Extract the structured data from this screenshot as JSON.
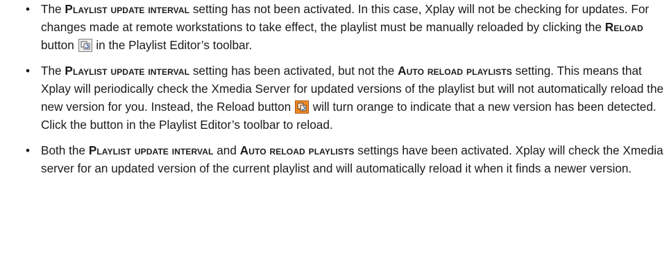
{
  "bullet_char": "•",
  "items": [
    {
      "t1": "The ",
      "s1": "Playlist update interval",
      "t2": " setting has not been activated. In this case, Xplay will not be checking for updates. For changes made at remote workstations to take effect, the playlist must be manually reloaded by clicking the ",
      "s2": "Reload",
      "t3": " button ",
      "t4": " in the Playlist Editor’s toolbar."
    },
    {
      "t1": "The ",
      "s1": "Playlist update interval",
      "t2": " setting has been activated, but not the ",
      "s2": "Auto reload playlists",
      "t3": " setting. This means that Xplay will periodically check the Xmedia Server for updated versions of the playlist but will not automatically reload the new version for you. Instead, the Reload button ",
      "t4": " will turn orange to indicate that a new version has been detected. Click the button in the Playlist Editor’s toolbar to reload."
    },
    {
      "t1": "Both the ",
      "s1": "Playlist update interval",
      "t2": " and ",
      "s2": "Auto reload playlists",
      "t3": " settings have been activated. Xplay will check the Xmedia server for an updated version of the current playlist and will automatically reload it when it finds a newer version."
    }
  ],
  "icons": {
    "reload_normal": "reload-icon",
    "reload_alert": "reload-orange-icon"
  },
  "colors": {
    "text": "#1a1a1a",
    "reload_alert_bg": "#f08a24"
  }
}
